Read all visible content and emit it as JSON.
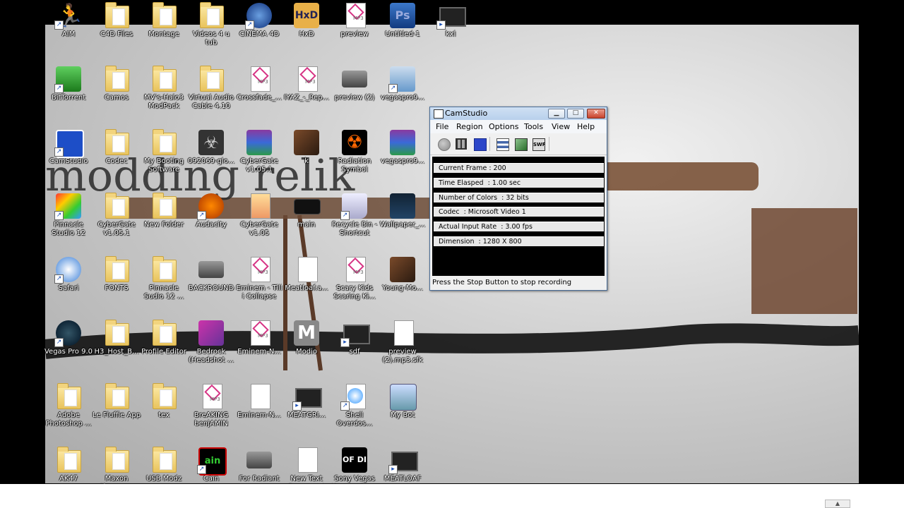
{
  "desktop": {
    "wallpaper_text": "modding relik",
    "icons": [
      {
        "label": "AIM",
        "type": "aim"
      },
      {
        "label": "C4D Files",
        "type": "folder"
      },
      {
        "label": "Montage",
        "type": "folder"
      },
      {
        "label": "Videos 4 u tub",
        "type": "folder"
      },
      {
        "label": "CINEMA 4D",
        "type": "c4d"
      },
      {
        "label": "HxD",
        "type": "hxd"
      },
      {
        "label": "preview",
        "type": "mp3"
      },
      {
        "label": "Untitled-1",
        "type": "psd"
      },
      {
        "label": "kxl",
        "type": "video"
      },
      {
        "label": "BitTorrent",
        "type": "bittorrent"
      },
      {
        "label": "Camos",
        "type": "folder"
      },
      {
        "label": "MV's-Halo3 ModPack",
        "type": "folder"
      },
      {
        "label": "Virtual Audio Cable 4.10",
        "type": "folder"
      },
      {
        "label": "Crossfade_...",
        "type": "mp3"
      },
      {
        "label": "IYAZ_-_Rep...",
        "type": "mp3"
      },
      {
        "label": "preview (2)",
        "type": "image"
      },
      {
        "label": "vegaspro9...",
        "type": "installer"
      },
      {
        "label": "CamStudio",
        "type": "camstudio"
      },
      {
        "label": "Codec",
        "type": "folder"
      },
      {
        "label": "My Booting Software",
        "type": "folder"
      },
      {
        "label": "092069-glo...",
        "type": "biohazard"
      },
      {
        "label": "CyberGate v1.05.1",
        "type": "winrar"
      },
      {
        "label": "k",
        "type": "photo"
      },
      {
        "label": "Radiation Symbol",
        "type": "radiation"
      },
      {
        "label": "vegaspro9...",
        "type": "winrar"
      },
      {
        "label": "Pinnacle Studio 12",
        "type": "pinnacle"
      },
      {
        "label": "CyberGate v1.05.1",
        "type": "folder"
      },
      {
        "label": "New Folder",
        "type": "folder"
      },
      {
        "label": "Audacity",
        "type": "audacity"
      },
      {
        "label": "CyberGate v1.05",
        "type": "cybergate"
      },
      {
        "label": "main",
        "type": "main"
      },
      {
        "label": "Recycle Bin - Shortcut",
        "type": "recycle"
      },
      {
        "label": "Wallpaper_...",
        "type": "wallpaper"
      },
      {
        "label": "Safari",
        "type": "safari"
      },
      {
        "label": "FONTS",
        "type": "folder"
      },
      {
        "label": "Pinnacle Sudio 12 ...",
        "type": "folder"
      },
      {
        "label": "BACKROUND",
        "type": "image"
      },
      {
        "label": "Eminem - Till i Collapse",
        "type": "mp3"
      },
      {
        "label": "Meatloaf.a...",
        "type": "file"
      },
      {
        "label": "Scary Kids Scaring Ki...",
        "type": "mp3"
      },
      {
        "label": "Young-Mo...",
        "type": "photo"
      },
      {
        "label": "Vegas Pro 9.0",
        "type": "vegas"
      },
      {
        "label": "H3_Host_B...",
        "type": "folder"
      },
      {
        "label": "Profile Editor",
        "type": "folder"
      },
      {
        "label": "Bedrock (Headshot ...",
        "type": "bedrock"
      },
      {
        "label": "Eminem-N...",
        "type": "mp3"
      },
      {
        "label": "Modio",
        "type": "modio"
      },
      {
        "label": "sdf",
        "type": "video"
      },
      {
        "label": "preview (2).mp3.sfk",
        "type": "file"
      },
      {
        "label": "Adobe Photoshop ...",
        "type": "folder"
      },
      {
        "label": "Le Fluffie App",
        "type": "folder"
      },
      {
        "label": "tex",
        "type": "folder"
      },
      {
        "label": "BreAKING benjAMIN",
        "type": "mp3"
      },
      {
        "label": "Eminem-N...",
        "type": "file"
      },
      {
        "label": "MEATGRI...",
        "type": "video"
      },
      {
        "label": "Shell Overdos...",
        "type": "shell"
      },
      {
        "label": "My Bot",
        "type": "mybot"
      },
      {
        "label": "AK47",
        "type": "folder"
      },
      {
        "label": "Maxon Cinema ...",
        "type": "folder"
      },
      {
        "label": "USB Modz",
        "type": "folder"
      },
      {
        "label": "Cain",
        "type": "cain"
      },
      {
        "label": "For Radiant",
        "type": "image"
      },
      {
        "label": "New Text Document",
        "type": "file"
      },
      {
        "label": "Sony Vegas Keygen By ...",
        "type": "keygen"
      },
      {
        "label": "MEATLOAF",
        "type": "video"
      }
    ]
  },
  "camstudio": {
    "title": "CamStudio",
    "menu": [
      "File",
      "Region",
      "Options",
      "Tools",
      "View",
      "Help"
    ],
    "stats": [
      "Current Frame : 200",
      "Time Elasped  : 1.00 sec",
      "Number of Colors  : 32 bits",
      "Codec  : Microsoft Video 1",
      "Actual Input Rate  : 3.00 fps",
      "Dimension  : 1280 X 800"
    ],
    "status": "Press the Stop Button to stop recording",
    "swf_label": "SWF"
  },
  "colors": {
    "desktop_bg": "#c8c8c8",
    "stop_button": "#2c46c9",
    "title_bar": "#c4d8f0"
  }
}
